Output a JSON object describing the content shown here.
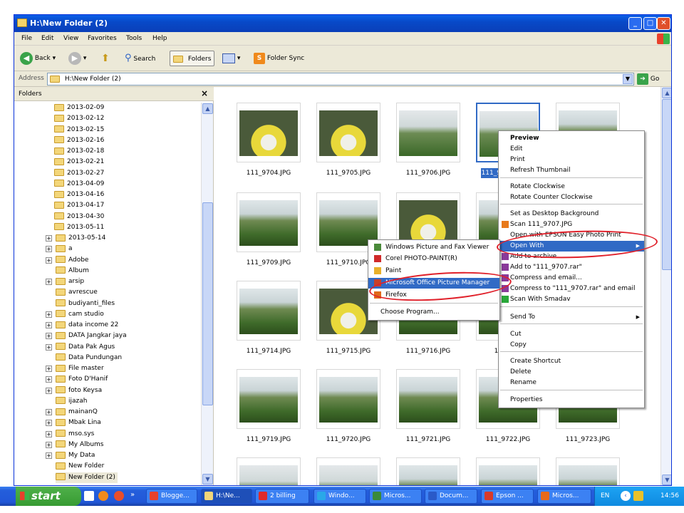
{
  "window": {
    "title": "H:\\New Folder (2)"
  },
  "menubar": [
    "File",
    "Edit",
    "View",
    "Favorites",
    "Tools",
    "Help"
  ],
  "toolbar": {
    "back": "Back",
    "search": "Search",
    "folders": "Folders",
    "folder_sync": "Folder Sync"
  },
  "address": {
    "label": "Address",
    "value": "H:\\New Folder (2)",
    "go": "Go"
  },
  "folders_pane": {
    "title": "Folders",
    "items": [
      "2013-02-09",
      "2013-02-12",
      "2013-02-15",
      "2013-02-16",
      "2013-02-18",
      "2013-02-21",
      "2013-02-27",
      "2013-04-09",
      "2013-04-16",
      "2013-04-17",
      "2013-04-30",
      "2013-05-11",
      "2013-05-14",
      "a",
      "Adobe",
      "Album",
      "arsip",
      "avrescue",
      "budiyanti_files",
      "cam studio",
      "data income 22",
      "DATA Jangkar jaya",
      "Data Pak Agus",
      "Data Pundungan",
      "File master",
      "Foto D'Hanif",
      "foto Keysa",
      "ijazah",
      "mainanQ",
      "Mbak Lina",
      "mso.sys",
      "My Albums",
      "My Data",
      "New Folder",
      "New Folder (2)"
    ]
  },
  "files": {
    "row1": [
      "111_9704.JPG",
      "111_9705.JPG",
      "111_9706.JPG",
      "111_970"
    ],
    "row2": [
      "111_9709.JPG",
      "111_9710.JPG"
    ],
    "row3": [
      "111_9714.JPG",
      "111_9715.JPG",
      "111_9716.JPG",
      "111_971"
    ],
    "row4": [
      "111_9719.JPG",
      "111_9720.JPG",
      "111_9721.JPG",
      "111_9722.JPG",
      "111_9723.JPG"
    ]
  },
  "context_menu": {
    "items": [
      "Preview",
      "Edit",
      "Print",
      "Refresh Thumbnail",
      "Rotate Clockwise",
      "Rotate Counter Clockwise",
      "Set as Desktop Background",
      "Scan 111_9707.JPG",
      "Open with EPSON Easy Photo Print",
      "Open With",
      "Add to archive...",
      "Add to \"111_9707.rar\"",
      "Compress and email...",
      "Compress to \"111_9707.rar\" and email",
      "Scan With Smadav",
      "Send To",
      "Cut",
      "Copy",
      "Create Shortcut",
      "Delete",
      "Rename",
      "Properties"
    ]
  },
  "open_with_menu": {
    "items": [
      "Windows Picture and Fax Viewer",
      "Corel PHOTO-PAINT(R)",
      "Paint",
      "Microsoft Office Picture Manager",
      "Firefox",
      "Choose Program..."
    ]
  },
  "taskbar": {
    "start": "start",
    "tasks": [
      "Blogge...",
      "H:\\Ne...",
      "2 billing",
      "Windo...",
      "Micros...",
      "Docum...",
      "Epson ...",
      "Micros..."
    ],
    "lang": "EN",
    "clock": "14:56"
  },
  "colors": {
    "title_blue": "#0a5fe8",
    "selection": "#316ac5",
    "taskbar": "#245edb",
    "start_green": "#379b32",
    "annotation_red": "#e0202a"
  },
  "icons": [
    "folder-icon",
    "back-arrow-icon",
    "forward-arrow-icon",
    "up-folder-icon",
    "search-icon",
    "views-icon",
    "go-arrow-icon",
    "windows-flag-icon",
    "close-icon",
    "minimize-icon",
    "maximize-icon"
  ]
}
